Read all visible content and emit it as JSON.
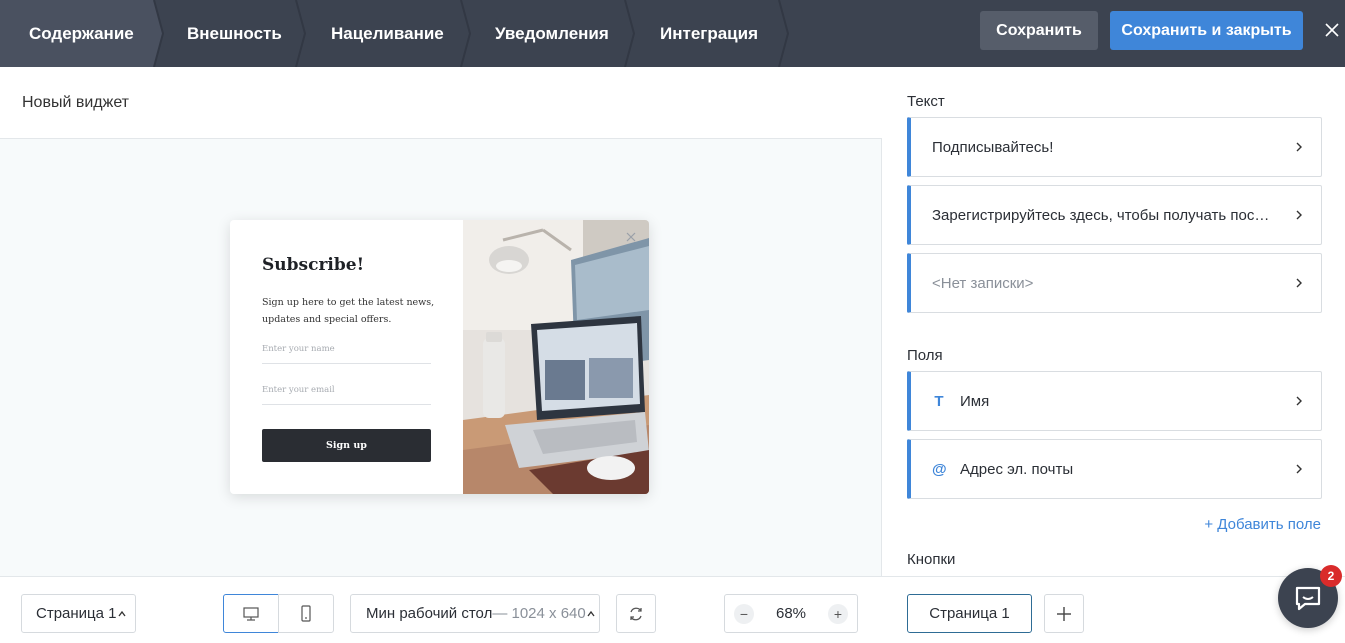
{
  "tabs": [
    {
      "label": "Содержание",
      "active": true
    },
    {
      "label": "Внешность",
      "active": false
    },
    {
      "label": "Нацеливание",
      "active": false
    },
    {
      "label": "Уведомления",
      "active": false
    },
    {
      "label": "Интеграция",
      "active": false
    }
  ],
  "header": {
    "save_label": "Сохранить",
    "save_close_label": "Сохранить и закрыть",
    "close_icon": "close-icon"
  },
  "editor": {
    "widget_name": "Новый виджет"
  },
  "preview": {
    "title": "Subscribe!",
    "description": "Sign up here to get the latest news, updates and special offers.",
    "name_placeholder": "Enter your name",
    "email_placeholder": "Enter your email",
    "button_label": "Sign up"
  },
  "panel": {
    "text_section": "Текст",
    "text_items": [
      {
        "label": "Подписывайтесь!",
        "muted": false
      },
      {
        "label": "Зарегистрируйтесь здесь, чтобы получать последние новости, обновления и специальные предложения.",
        "muted": false
      },
      {
        "label": "<Нет записки>",
        "muted": true
      }
    ],
    "fields_section": "Поля",
    "field_items": [
      {
        "icon": "T",
        "label": "Имя"
      },
      {
        "icon": "@",
        "label": "Адрес эл. почты"
      }
    ],
    "add_field_label": "+ Добавить поле",
    "buttons_section": "Кнопки"
  },
  "bottom": {
    "page_select": "Страница 1",
    "resolution_label": "Мин рабочий стол",
    "resolution_dims": "— 1024 x 640",
    "zoom_value": "68%",
    "page_tab": "Страница 1"
  },
  "chat": {
    "badge_count": "2"
  },
  "colors": {
    "topbar": "#3c4350",
    "accent": "#3f86d9",
    "badge": "#d92b2b"
  }
}
